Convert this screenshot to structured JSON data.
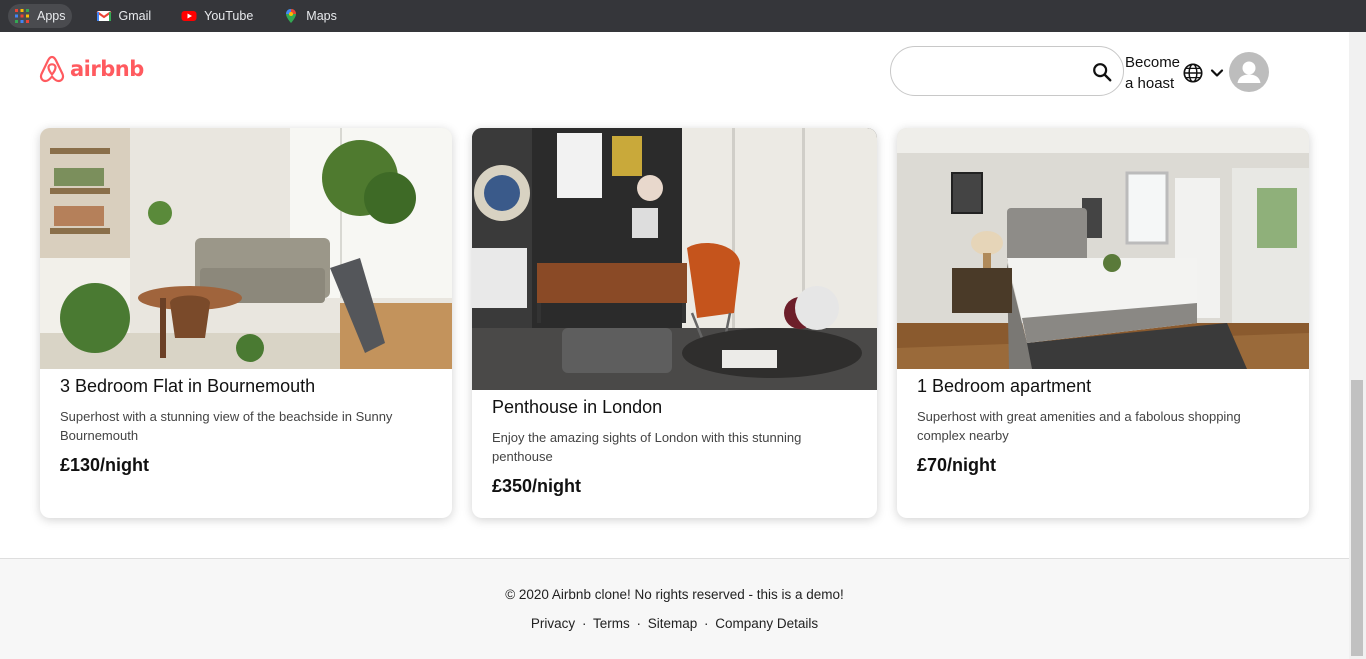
{
  "bookmarks": [
    {
      "label": "Apps",
      "icon": "apps-grid-icon"
    },
    {
      "label": "Gmail",
      "icon": "gmail-icon"
    },
    {
      "label": "YouTube",
      "icon": "youtube-icon"
    },
    {
      "label": "Maps",
      "icon": "maps-pin-icon"
    }
  ],
  "header": {
    "logo_text": "airbnb",
    "search_value": "",
    "become_host_line1": "Become",
    "become_host_line2": "a hoast"
  },
  "cards": [
    {
      "title": "3 Bedroom Flat in Bournemouth",
      "description": "Superhost with a stunning view of the beachside in Sunny Bournemouth",
      "price": "£130/night"
    },
    {
      "title": "Penthouse in London",
      "description": "Enjoy the amazing sights of London with this stunning penthouse",
      "price": "£350/night"
    },
    {
      "title": "1 Bedroom apartment",
      "description": "Superhost with great amenities and a fabolous shopping complex nearby",
      "price": "£70/night"
    }
  ],
  "footer": {
    "copyright": "© 2020 Airbnb clone! No rights reserved - this is a demo!",
    "links": [
      "Privacy",
      "Terms",
      "Sitemap",
      "Company Details"
    ],
    "separator": "·"
  },
  "colors": {
    "brand": "#ff5a5f",
    "bookmarks_bg": "#35363a",
    "footer_bg": "#f7f7f7"
  }
}
